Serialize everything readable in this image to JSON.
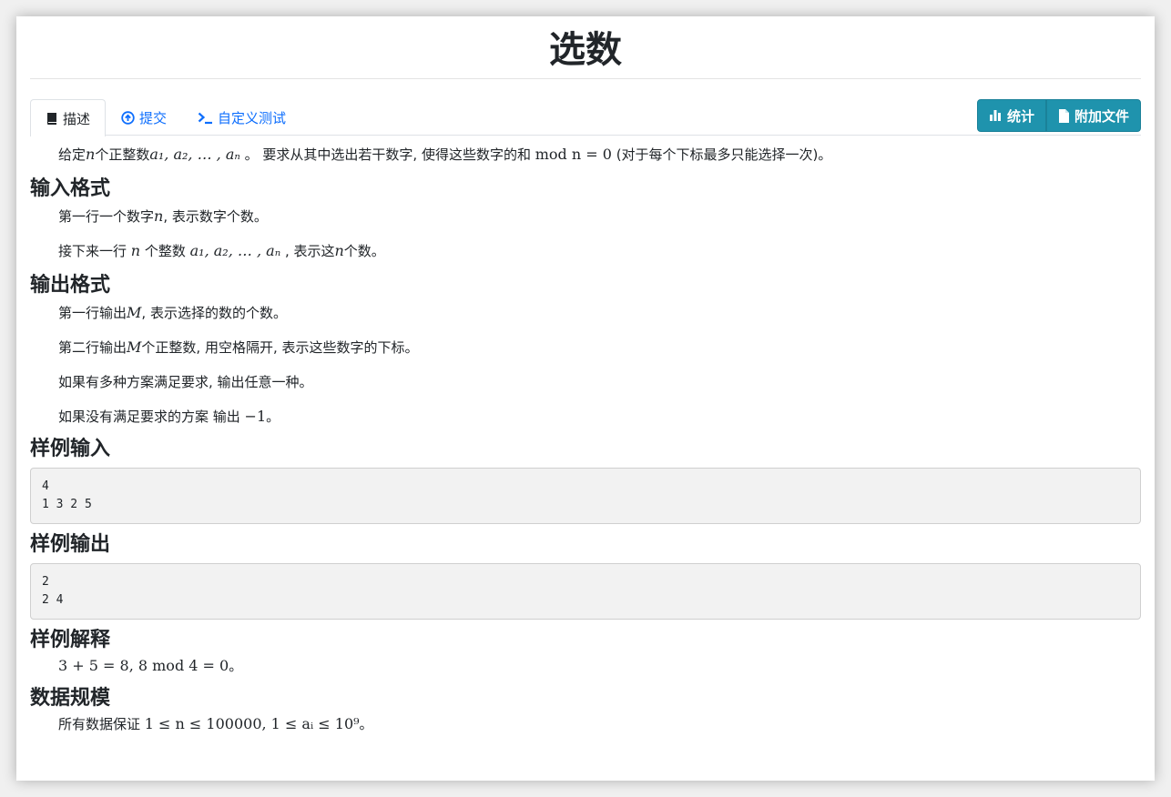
{
  "page": {
    "title": "选数"
  },
  "tabs": [
    {
      "label": "描述",
      "icon": "book-icon",
      "active": true
    },
    {
      "label": "提交",
      "icon": "upload-circle-icon",
      "active": false
    },
    {
      "label": "自定义测试",
      "icon": "terminal-icon",
      "active": false
    }
  ],
  "buttons": [
    {
      "label": "统计",
      "icon": "bar-chart-icon"
    },
    {
      "label": "附加文件",
      "icon": "file-icon"
    }
  ],
  "description": {
    "intro_pre": "给定",
    "intro_n": "n",
    "intro_mid": "个正整数",
    "intro_seq": "a₁, a₂, … , aₙ",
    "intro_post": " 。 要求从其中选出若干数字, 使得这些数字的和 ",
    "intro_formula": "mod n = 0",
    "intro_tail": " (对于每个下标最多只能选择一次)。"
  },
  "input_format": {
    "heading": "输入格式",
    "line1_pre": "第一行一个数字",
    "line1_var": "n",
    "line1_post": ", 表示数字个数。",
    "line2_pre": "接下来一行 ",
    "line2_var": "n",
    "line2_mid": " 个整数 ",
    "line2_seq": "a₁, a₂, … , aₙ",
    "line2_post": " , 表示这",
    "line2_var2": "n",
    "line2_tail": "个数。"
  },
  "output_format": {
    "heading": "输出格式",
    "line1_pre": "第一行输出",
    "line1_var": "M",
    "line1_post": ", 表示选择的数的个数。",
    "line2_pre": "第二行输出",
    "line2_var": "M",
    "line2_post": "个正整数, 用空格隔开, 表示这些数字的下标。",
    "line3": "如果有多种方案满足要求, 输出任意一种。",
    "line4_pre": "如果没有满足要求的方案 输出 ",
    "line4_val": "−1",
    "line4_post": "。"
  },
  "sample_input": {
    "heading": "样例输入",
    "lines": [
      "4",
      "1 3 2 5"
    ]
  },
  "sample_output": {
    "heading": "样例输出",
    "lines": [
      "2",
      "2 4"
    ]
  },
  "sample_explain": {
    "heading": "样例解释",
    "formula": "3 + 5 = 8, 8  mod  4 = 0",
    "tail": "。"
  },
  "data_scale": {
    "heading": "数据规模",
    "pre": "所有数据保证 ",
    "formula": "1 ≤ n ≤ 100000, 1 ≤ aᵢ ≤ 10⁹",
    "tail": "。"
  },
  "colors": {
    "accent": "#1f93ad",
    "link": "#0d6efd",
    "code_bg": "#f2f2f2"
  }
}
